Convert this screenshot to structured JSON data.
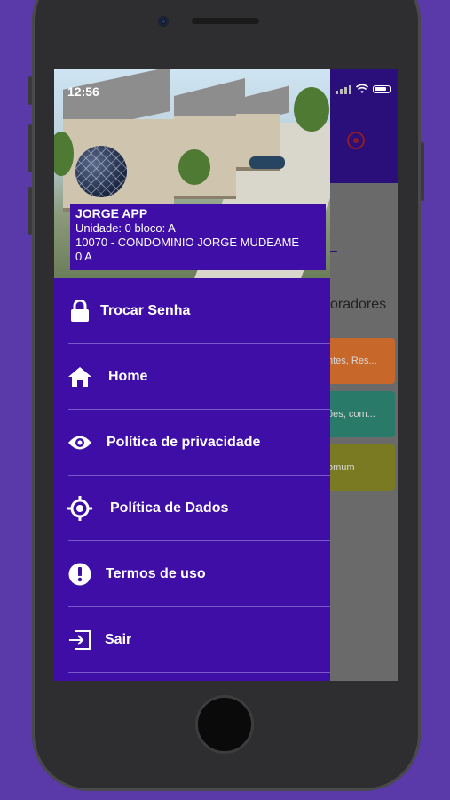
{
  "status_bar": {
    "time": "12:56"
  },
  "background_app": {
    "section_title": "oradores",
    "cards": [
      {
        "label": "ntes, Res...",
        "color": "#c7672a"
      },
      {
        "label": "ões, com...",
        "color": "#2a7a6a"
      },
      {
        "label": "omum",
        "color": "#7a7a23"
      }
    ]
  },
  "drawer": {
    "app_name": "JORGE APP",
    "unit_line": "Unidade: 0 bloco: A",
    "condo_line": "10070 - CONDOMINIO JORGE MUDEAME",
    "condo_line_2": "0 A",
    "menu": [
      {
        "label": "Trocar Senha",
        "icon": "lock-icon"
      },
      {
        "label": "Home",
        "icon": "home-icon"
      },
      {
        "label": "Política de privacidade",
        "icon": "eye-icon"
      },
      {
        "label": "Política de Dados",
        "icon": "crosshair-icon"
      },
      {
        "label": "Termos de uso",
        "icon": "alert-icon"
      },
      {
        "label": "Sair",
        "icon": "logout-icon"
      }
    ]
  },
  "colors": {
    "drawer": "#3f0ea6",
    "page_background": "#5a3aa8"
  }
}
